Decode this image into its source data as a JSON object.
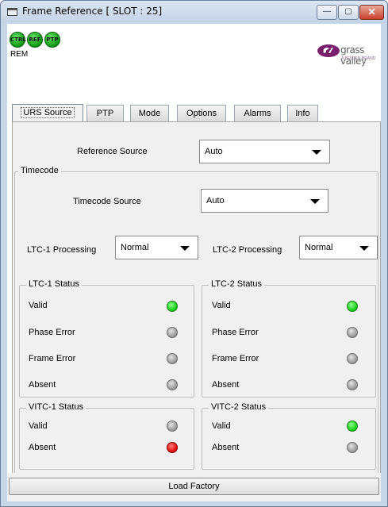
{
  "window": {
    "title": "Frame Reference [ SLOT : 25]",
    "controls": {
      "minimize": "—",
      "maximize": "▢",
      "close": "✕"
    }
  },
  "header": {
    "indicators": [
      {
        "label": "CTRL",
        "color": "#12c912"
      },
      {
        "label": "REF",
        "color": "#12c912"
      },
      {
        "label": "PTP",
        "color": "#12c912"
      }
    ],
    "rem_label": "REM",
    "brand": {
      "name": "grass valley",
      "sub": "A BELDEN BRAND",
      "color": "#7a1f6e"
    }
  },
  "tabs": [
    "URS Source",
    "PTP",
    "Mode",
    "Options",
    "Alarms",
    "Info"
  ],
  "active_tab": "URS Source",
  "reference": {
    "label": "Reference Source",
    "value": "Auto"
  },
  "timecode": {
    "group_title": "Timecode",
    "source": {
      "label": "Timecode Source",
      "value": "Auto"
    },
    "ltc1_processing": {
      "label": "LTC-1 Processing",
      "value": "Normal"
    },
    "ltc2_processing": {
      "label": "LTC-2 Processing",
      "value": "Normal"
    }
  },
  "ltc1_status": {
    "title": "LTC-1 Status",
    "rows": [
      {
        "label": "Valid",
        "state": "green"
      },
      {
        "label": "Phase Error",
        "state": "grey"
      },
      {
        "label": "Frame Error",
        "state": "grey"
      },
      {
        "label": "Absent",
        "state": "grey"
      }
    ]
  },
  "ltc2_status": {
    "title": "LTC-2 Status",
    "rows": [
      {
        "label": "Valid",
        "state": "green"
      },
      {
        "label": "Phase Error",
        "state": "grey"
      },
      {
        "label": "Frame Error",
        "state": "grey"
      },
      {
        "label": "Absent",
        "state": "grey"
      }
    ]
  },
  "vitc1_status": {
    "title": "VITC-1 Status",
    "rows": [
      {
        "label": "Valid",
        "state": "grey"
      },
      {
        "label": "Absent",
        "state": "red"
      }
    ]
  },
  "vitc2_status": {
    "title": "VITC-2 Status",
    "rows": [
      {
        "label": "Valid",
        "state": "green"
      },
      {
        "label": "Absent",
        "state": "grey"
      }
    ]
  },
  "footer": {
    "load_factory": "Load Factory"
  },
  "colors": {
    "led_green": "#12c912",
    "led_grey": "#8f8f8f",
    "led_red": "#e00000",
    "window_frame": "#c7d6e8",
    "close_button": "#c9402b"
  }
}
